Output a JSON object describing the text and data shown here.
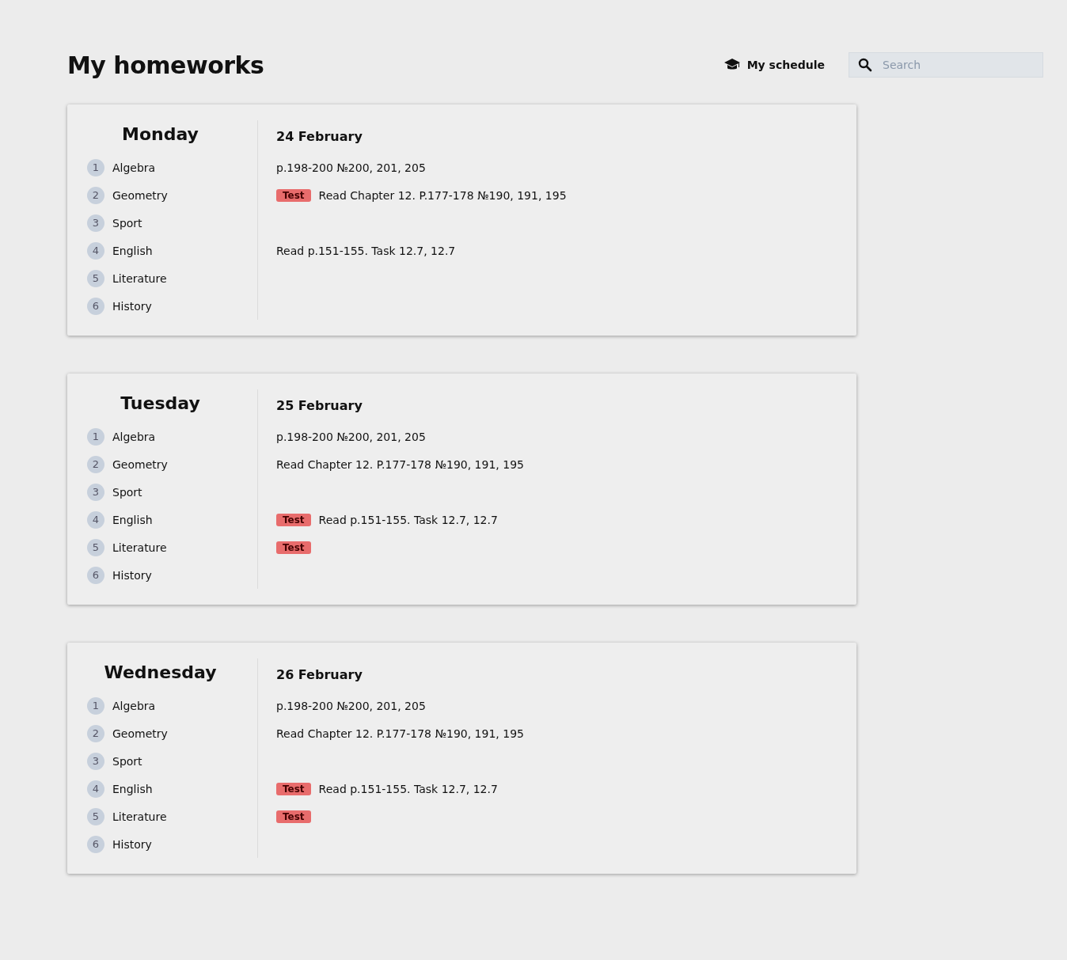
{
  "title": "My homeworks",
  "schedule_link": {
    "label": "My schedule"
  },
  "search": {
    "placeholder": "Search"
  },
  "days": [
    {
      "day": "Monday",
      "date": "24 February",
      "lessons": [
        {
          "number": "1",
          "subject": "Algebra",
          "task": "p.198-200 №200, 201, 205"
        },
        {
          "number": "2",
          "subject": "Geometry",
          "badge": "Test",
          "task": "Read Chapter 12. P.177-178 №190, 191, 195"
        },
        {
          "number": "3",
          "subject": "Sport"
        },
        {
          "number": "4",
          "subject": "English",
          "task": "Read p.151-155. Task 12.7, 12.7"
        },
        {
          "number": "5",
          "subject": "Literature"
        },
        {
          "number": "6",
          "subject": "History"
        }
      ]
    },
    {
      "day": "Tuesday",
      "date": "25 February",
      "lessons": [
        {
          "number": "1",
          "subject": "Algebra",
          "task": "p.198-200 №200, 201, 205"
        },
        {
          "number": "2",
          "subject": "Geometry",
          "task": "Read Chapter 12. P.177-178 №190, 191, 195"
        },
        {
          "number": "3",
          "subject": "Sport"
        },
        {
          "number": "4",
          "subject": "English",
          "badge": "Test",
          "task": "Read p.151-155. Task 12.7, 12.7"
        },
        {
          "number": "5",
          "subject": "Literature",
          "badge": "Test"
        },
        {
          "number": "6",
          "subject": "History"
        }
      ]
    },
    {
      "day": "Wednesday",
      "date": "26 February",
      "lessons": [
        {
          "number": "1",
          "subject": "Algebra",
          "task": "p.198-200 №200, 201, 205"
        },
        {
          "number": "2",
          "subject": "Geometry",
          "task": "Read Chapter 12. P.177-178 №190, 191, 195"
        },
        {
          "number": "3",
          "subject": "Sport"
        },
        {
          "number": "4",
          "subject": "English",
          "badge": "Test",
          "task": "Read p.151-155. Task 12.7, 12.7"
        },
        {
          "number": "5",
          "subject": "Literature",
          "badge": "Test"
        },
        {
          "number": "6",
          "subject": "History"
        }
      ]
    }
  ]
}
